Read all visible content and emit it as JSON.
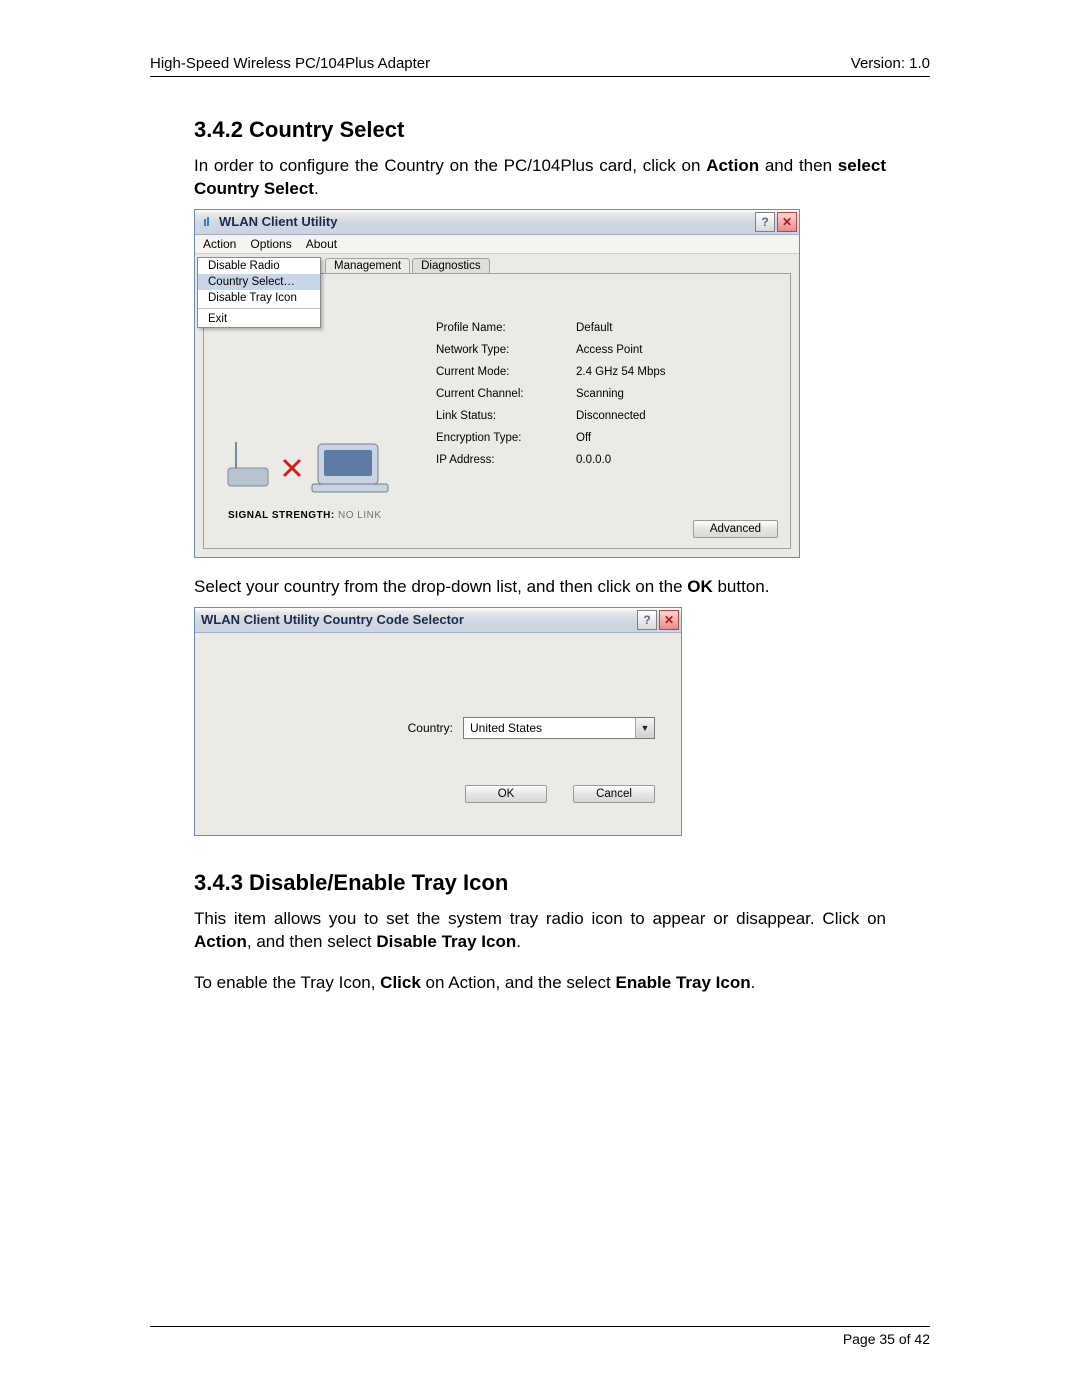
{
  "header": {
    "left": "High-Speed Wireless PC/104Plus Adapter",
    "right": "Version: 1.0"
  },
  "sec1": {
    "heading": "3.4.2 Country Select",
    "p1a": "In order to configure the Country on the PC/104Plus card, click on ",
    "p1b": "Action",
    "p1c": " and then ",
    "p1d": "select Country Select",
    "p1e": ".",
    "p2a": "Select your country from the drop-down list, and then click on the ",
    "p2b": "OK",
    "p2c": " button."
  },
  "win1": {
    "title": "WLAN Client Utility",
    "menu": {
      "action": "Action",
      "options": "Options",
      "about": "About"
    },
    "action_items": {
      "disable_radio": "Disable Radio",
      "country_select": "Country Select…",
      "disable_tray": "Disable Tray Icon",
      "exit": "Exit"
    },
    "tabs": {
      "management": "Management",
      "diagnostics": "Diagnostics"
    },
    "info": {
      "profile_l": "Profile Name:",
      "profile_v": "Default",
      "nettype_l": "Network Type:",
      "nettype_v": "Access Point",
      "mode_l": "Current Mode:",
      "mode_v": "2.4 GHz 54 Mbps",
      "chan_l": "Current Channel:",
      "chan_v": "Scanning",
      "link_l": "Link Status:",
      "link_v": "Disconnected",
      "enc_l": "Encryption Type:",
      "enc_v": "Off",
      "ip_l": "IP Address:",
      "ip_v": "0.0.0.0"
    },
    "sig_lbl": "SIGNAL STRENGTH:",
    "sig_val": " NO LINK",
    "advanced": "Advanced"
  },
  "win2": {
    "title": "WLAN Client Utility Country Code Selector",
    "label": "Country:",
    "value": "United States",
    "ok": "OK",
    "cancel": "Cancel"
  },
  "sec2": {
    "heading": "3.4.3 Disable/Enable Tray Icon",
    "p1a": "This item allows you to set the system tray radio icon to appear or disappear. Click on ",
    "p1b": "Action",
    "p1c": ", and then select ",
    "p1d": "Disable Tray Icon",
    "p1e": ".",
    "p2a": "To enable the Tray Icon, ",
    "p2b": "Click",
    "p2c": " on Action, and the select ",
    "p2d": "Enable Tray Icon",
    "p2e": "."
  },
  "footer": "Page 35 of 42"
}
